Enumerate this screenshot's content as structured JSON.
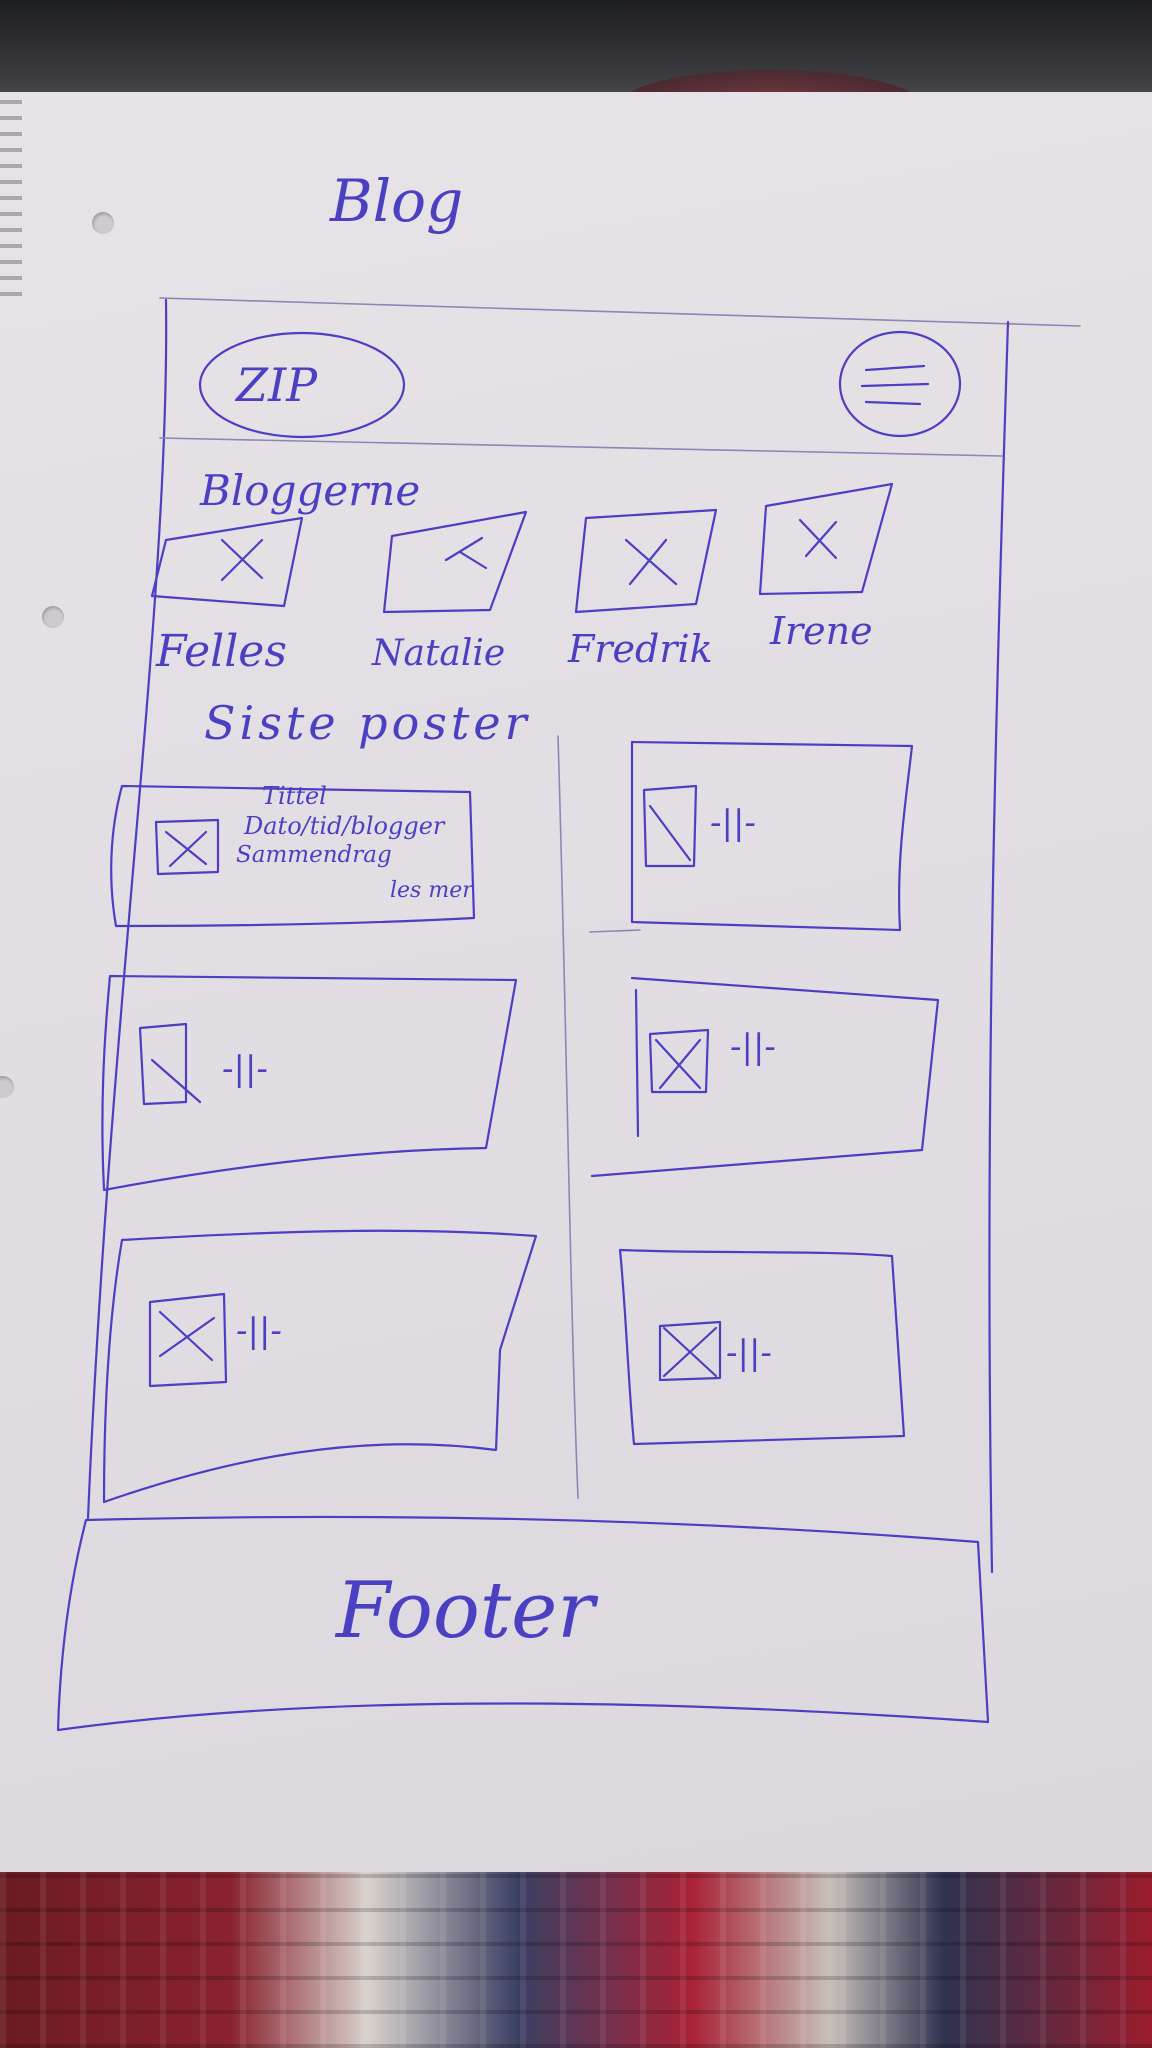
{
  "sketch": {
    "page_heading": "Blog",
    "header": {
      "logo_text": "ZIP",
      "menu_icon": "hamburger-menu-icon"
    },
    "bloggers_heading": "Bloggerne",
    "bloggers": [
      {
        "name": "Felles",
        "avatar_icon": "image-placeholder-icon"
      },
      {
        "name": "Natalie",
        "avatar_icon": "image-placeholder-icon"
      },
      {
        "name": "Fredrik",
        "avatar_icon": "image-placeholder-icon"
      },
      {
        "name": "Irene",
        "avatar_icon": "image-placeholder-icon"
      }
    ],
    "latest_posts_heading": "Siste poster",
    "post_card": {
      "line_1": "Tittel",
      "line_2": "Dato/tid/blogger",
      "line_3": "Sammendrag",
      "read_more": "les mer"
    },
    "repeat_mark": "-||-",
    "footer_text": "Footer",
    "ink_color": "#4b3fc2",
    "paper_color": "#e4e0e5"
  }
}
